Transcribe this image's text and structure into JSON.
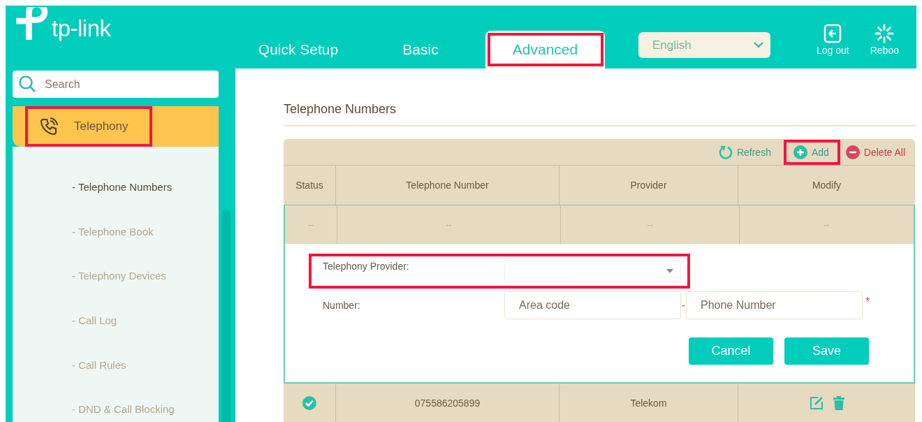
{
  "brand": {
    "name": "tp-link"
  },
  "nav_tabs": [
    {
      "label": "Quick Setup",
      "selected": false,
      "highlighted": false
    },
    {
      "label": "Basic",
      "selected": false,
      "highlighted": false
    },
    {
      "label": "Advanced",
      "selected": true,
      "highlighted": true
    }
  ],
  "language": {
    "value": "English"
  },
  "header_actions": [
    {
      "label": "Log out",
      "kind": "logout"
    },
    {
      "label": "Reboo",
      "kind": "reboot"
    }
  ],
  "search": {
    "placeholder": "Search"
  },
  "sidebar": {
    "section": {
      "label": "Telephony",
      "selected": true,
      "highlighted": true
    },
    "items": [
      {
        "label": "- Telephone Numbers",
        "selected": true
      },
      {
        "label": "- Telephone Book",
        "selected": false
      },
      {
        "label": "- Telephony Devices",
        "selected": false
      },
      {
        "label": "- Call Log",
        "selected": false
      },
      {
        "label": "- Call Rules",
        "selected": false
      },
      {
        "label": "- DND & Call Blocking",
        "selected": false
      }
    ]
  },
  "page": {
    "title": "Telephone Numbers"
  },
  "toolbar": [
    {
      "label": "Refresh",
      "kind": "refresh",
      "highlighted": false
    },
    {
      "label": "Add",
      "kind": "add",
      "highlighted": true
    },
    {
      "label": "Delete All",
      "kind": "delete",
      "highlighted": false
    }
  ],
  "table": {
    "columns": [
      "Status",
      "Telephone Number",
      "Provider",
      "Modify"
    ],
    "pending_row": [
      "--",
      "--",
      "--",
      "--"
    ],
    "rows": [
      {
        "ok": true,
        "number": "075586205899",
        "provider": "Telekom"
      }
    ]
  },
  "form": {
    "provider": {
      "label": "Telephony Provider:",
      "highlighted": true
    },
    "number": {
      "label": "Number:",
      "area_placeholder": "Area code",
      "separator": "-",
      "number_placeholder": "Phone Number",
      "required_mark": "*"
    },
    "buttons": [
      "Cancel",
      "Save"
    ]
  }
}
